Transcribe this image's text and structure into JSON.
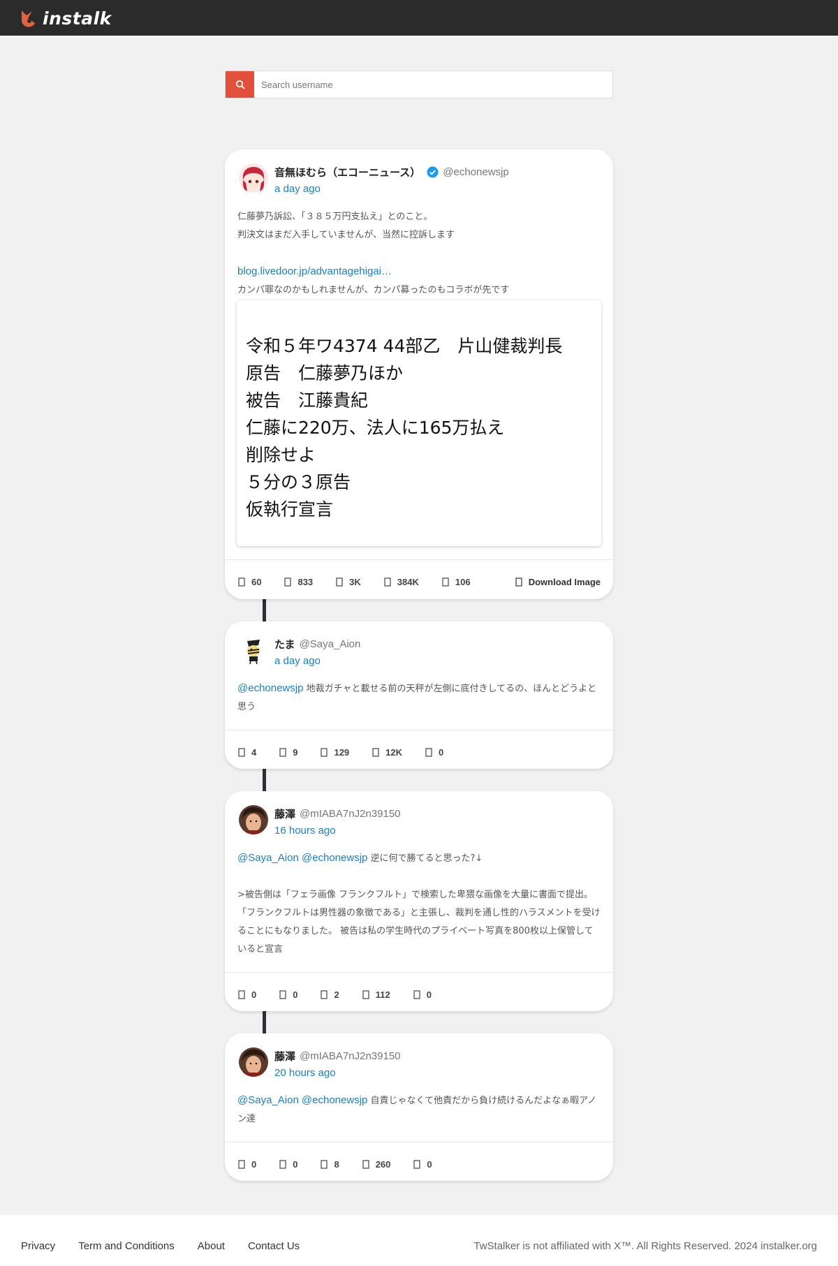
{
  "header": {
    "logo_text": "instalk"
  },
  "search": {
    "placeholder": "Search username",
    "icon": "search-icon"
  },
  "posts": [
    {
      "name": "音無ほむら（エコーニュース）",
      "verified": true,
      "handle": "@echonewsjp",
      "time": "a day ago",
      "lines": [
        "仁藤夢乃訴訟、「３８５万円支払え」とのこと。",
        "判決文はまだ入手していませんが、当然に控訴します",
        ""
      ],
      "link": "blog.livedoor.jp/advantagehigai…",
      "after_link": "カンパ罪なのかもしれませんが、カンパ募ったのもコラボが先です",
      "media_lines": [
        "令和５年ワ4374 44部乙　片山健裁判長",
        "原告　仁藤夢乃ほか",
        "被告　江藤貴紀",
        "仁藤に220万、法人に165万払え",
        "削除せよ",
        "５分の３原告",
        "仮執行宣言"
      ],
      "stats": {
        "replies": "60",
        "retweets": "833",
        "likes": "3K",
        "views": "384K",
        "bookmarks": "106"
      },
      "download_label": "Download Image"
    },
    {
      "name": "たま",
      "name_suffix_glyph": "",
      "handle": "@Saya_Aion",
      "time": "a day ago",
      "mention": "@echonewsjp",
      "text": " 地裁ガチャと載せる前の天秤が左側に底付きしてるの、ほんとどうよと思う",
      "stats": {
        "replies": "4",
        "retweets": "9",
        "likes": "129",
        "views": "12K",
        "bookmarks": "0"
      }
    },
    {
      "name": "藤澤",
      "handle": "@mIABA7nJ2n39150",
      "time": "16 hours ago",
      "mention1": "@Saya_Aion",
      "mention2": "@echonewsjp",
      "text": " 逆に何で勝てると思った?↓",
      "quote": " >被告側は「フェラ画像 フランクフルト」で検索した卑猥な画像を大量に書面で提出。「フランクフルトは男性器の象徴である」と主張し、裁判を通し性的ハラスメントを受けることにもなりました。 被告は私の学生時代のプライベート写真を800枚以上保管していると宣言",
      "stats": {
        "replies": "0",
        "retweets": "0",
        "likes": "2",
        "views": "112",
        "bookmarks": "0"
      }
    },
    {
      "name": "藤澤",
      "handle": "@mIABA7nJ2n39150",
      "time": "20 hours ago",
      "mention1": "@Saya_Aion",
      "mention2": "@echonewsjp",
      "text": " 自責じゃなくて他責だから負け続けるんだよなぁ暇アノン達",
      "stats": {
        "replies": "0",
        "retweets": "0",
        "likes": "8",
        "views": "260",
        "bookmarks": "0"
      }
    }
  ],
  "footer": {
    "links": [
      "Privacy",
      "Term and Conditions",
      "About",
      "Contact Us"
    ],
    "notice": "TwStalker is not affiliated with X™. All Rights Reserved.  2024 instalker.org"
  },
  "colors": {
    "topbar": "#2b2b2b",
    "accent": "#e2503c",
    "link": "#1a7fc1",
    "background": "#f1f1f1"
  }
}
